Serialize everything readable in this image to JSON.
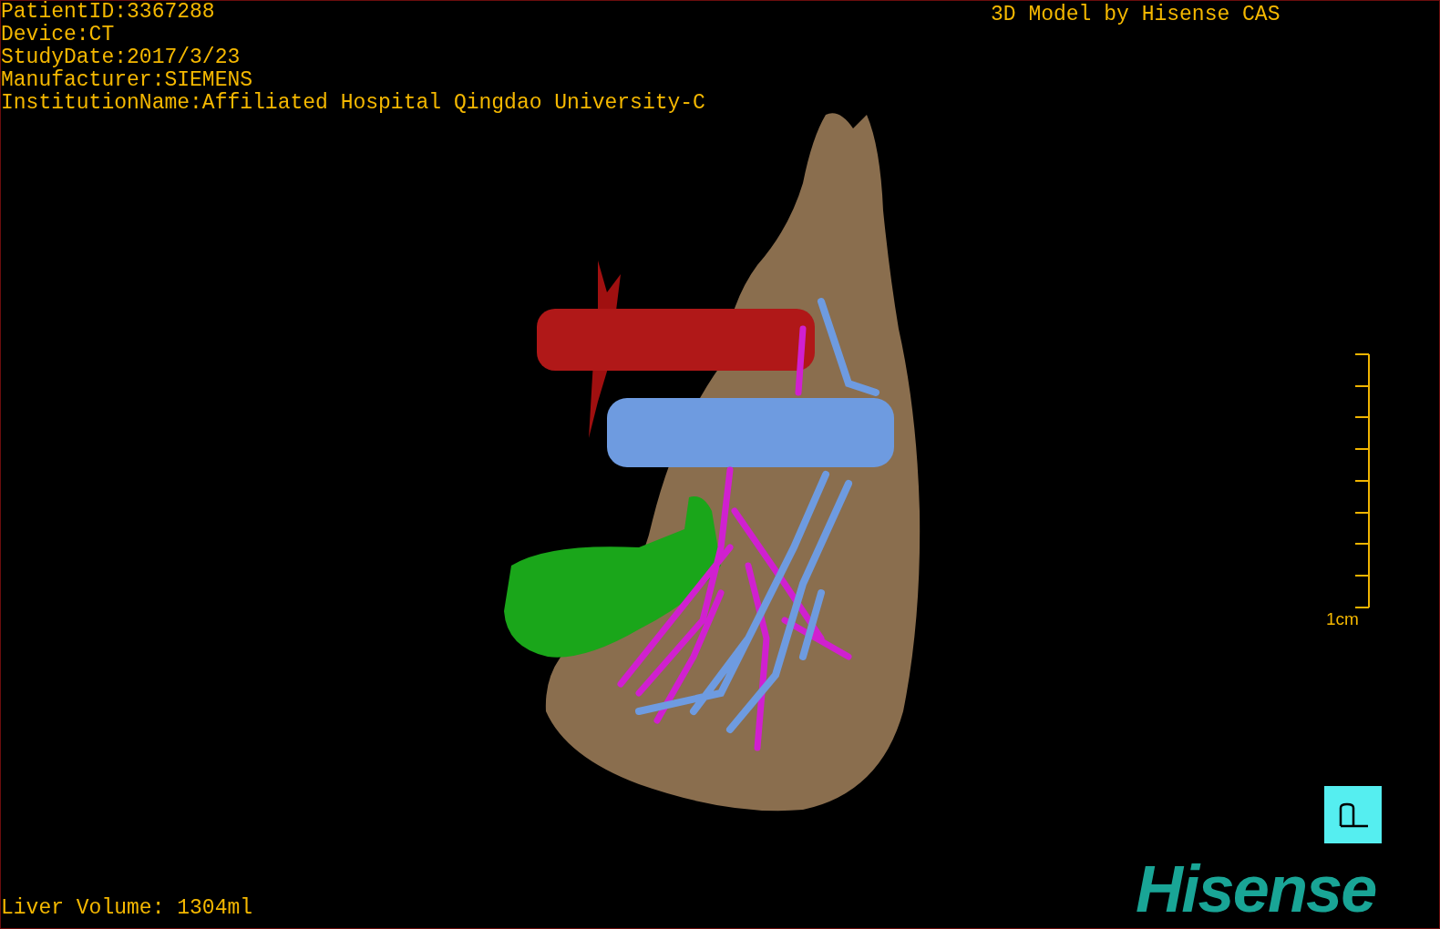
{
  "patient_info": [
    "PatientID:3367288",
    "Device:CT",
    "StudyDate:2017/3/23",
    "Manufacturer:SIEMENS",
    "InstitutionName:Affiliated Hospital Qingdao University-C"
  ],
  "header_right": "3D Model by Hisense CAS",
  "scale_bar": {
    "label": "1cm"
  },
  "volume": "Liver Volume: 1304ml",
  "logo": "Hisense"
}
